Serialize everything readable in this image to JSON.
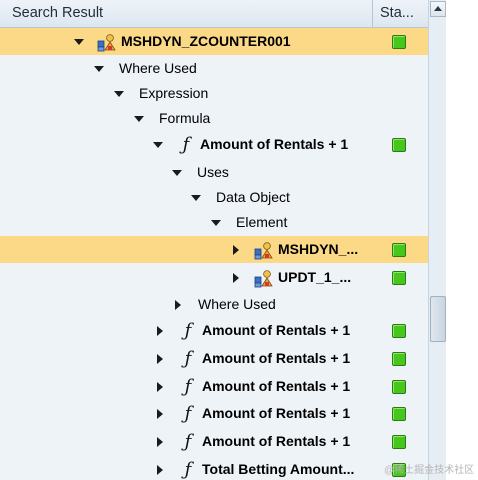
{
  "header": {
    "col_name": "Search Result",
    "col_status": "Sta..."
  },
  "rows": [
    {
      "label": "MSHDYN_ZCOUNTER001",
      "bold": true,
      "icon": "data-object-icon",
      "expander": "expanded",
      "status": "green",
      "selected": true
    },
    {
      "label": "Where Used",
      "bold": false,
      "icon": "",
      "expander": "expanded",
      "status": "",
      "selected": false
    },
    {
      "label": "Expression",
      "bold": false,
      "icon": "",
      "expander": "expanded",
      "status": "",
      "selected": false
    },
    {
      "label": "Formula",
      "bold": false,
      "icon": "",
      "expander": "expanded",
      "status": "",
      "selected": false
    },
    {
      "label": "Amount of Rentals + 1",
      "bold": true,
      "icon": "formula-icon",
      "expander": "expanded",
      "status": "green",
      "selected": false
    },
    {
      "label": "Uses",
      "bold": false,
      "icon": "",
      "expander": "expanded",
      "status": "",
      "selected": false
    },
    {
      "label": "Data Object",
      "bold": false,
      "icon": "",
      "expander": "expanded",
      "status": "",
      "selected": false
    },
    {
      "label": "Element",
      "bold": false,
      "icon": "",
      "expander": "expanded",
      "status": "",
      "selected": false
    },
    {
      "label": "MSHDYN_...",
      "bold": true,
      "icon": "data-object-icon",
      "expander": "collapsed",
      "status": "green",
      "selected": true
    },
    {
      "label": "UPDT_1_...",
      "bold": true,
      "icon": "data-object-icon",
      "expander": "collapsed",
      "status": "green",
      "selected": false
    },
    {
      "label": "Where Used",
      "bold": false,
      "icon": "",
      "expander": "collapsed",
      "status": "",
      "selected": false
    },
    {
      "label": "Amount of Rentals + 1",
      "bold": true,
      "icon": "formula-icon",
      "expander": "collapsed",
      "status": "green",
      "selected": false
    },
    {
      "label": "Amount of Rentals + 1",
      "bold": true,
      "icon": "formula-icon",
      "expander": "collapsed",
      "status": "green",
      "selected": false
    },
    {
      "label": "Amount of Rentals + 1",
      "bold": true,
      "icon": "formula-icon",
      "expander": "collapsed",
      "status": "green",
      "selected": false
    },
    {
      "label": "Amount of Rentals + 1",
      "bold": true,
      "icon": "formula-icon",
      "expander": "collapsed",
      "status": "green",
      "selected": false
    },
    {
      "label": "Amount of Rentals + 1",
      "bold": true,
      "icon": "formula-icon",
      "expander": "collapsed",
      "status": "green",
      "selected": false
    },
    {
      "label": "Total Betting Amount...",
      "bold": true,
      "icon": "formula-icon",
      "expander": "collapsed",
      "status": "green",
      "selected": false
    }
  ],
  "watermark": "@稀土掘金技术社区",
  "colors": {
    "selection": "#fbd987",
    "status_green": "#47c61e",
    "background": "#eef3f8"
  }
}
